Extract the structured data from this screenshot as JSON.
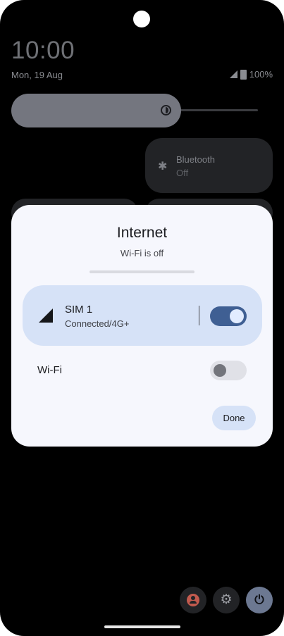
{
  "status_bar": {
    "time": "10:00",
    "date": "Mon, 19 Aug",
    "battery": "100%"
  },
  "quick_settings": {
    "brightness_level": 0.62,
    "bluetooth": {
      "label": "Bluetooth",
      "state": "Off"
    }
  },
  "internet_dialog": {
    "title": "Internet",
    "subtitle": "Wi-Fi is off",
    "sim": {
      "name": "SIM 1",
      "status": "Connected/4G+",
      "enabled": true
    },
    "wifi": {
      "label": "Wi-Fi",
      "enabled": false
    },
    "done_label": "Done"
  },
  "bottom_controls": [
    "user-icon",
    "gear-icon",
    "power-icon"
  ],
  "colors": {
    "accent": "#3f5f93",
    "card": "#d6e2f7",
    "dialog_bg": "#f6f7fd"
  }
}
